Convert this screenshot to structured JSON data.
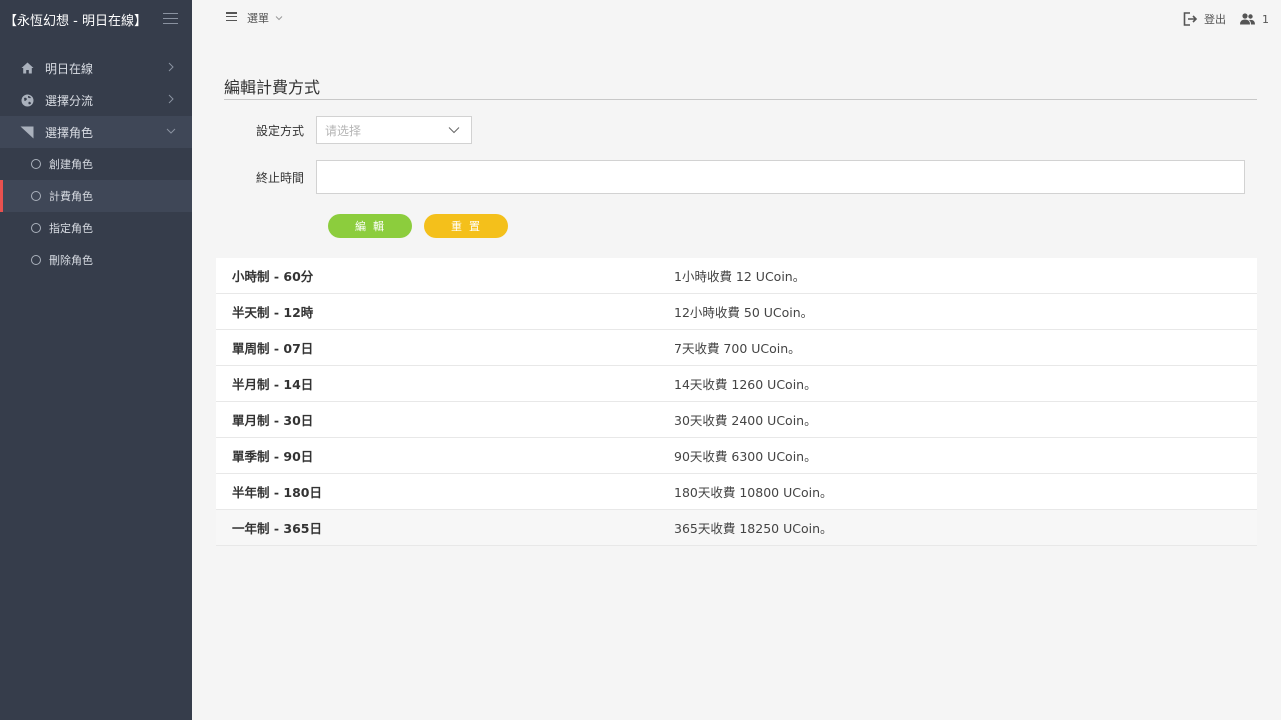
{
  "app": {
    "title": "【永恆幻想 - 明日在線】"
  },
  "sidebar": {
    "items": [
      {
        "label": "明日在線",
        "icon": "home-icon"
      },
      {
        "label": "選擇分流",
        "icon": "globe-icon"
      },
      {
        "label": "選擇角色",
        "icon": "flag-icon"
      }
    ],
    "subitems": [
      {
        "label": "創建角色"
      },
      {
        "label": "計費角色"
      },
      {
        "label": "指定角色"
      },
      {
        "label": "刪除角色"
      }
    ]
  },
  "topbar": {
    "menu_label": "選單",
    "logout_label": "登出",
    "user_count": "1"
  },
  "form": {
    "title": "編輯計費方式",
    "method_label": "設定方式",
    "method_placeholder": "请选择",
    "end_time_label": "終止時間",
    "end_time_value": "",
    "edit_button": "編輯",
    "reset_button": "重置"
  },
  "plans": [
    {
      "plan": "小時制 - 60分",
      "desc": "1小時收費 12 UCoin。"
    },
    {
      "plan": "半天制 - 12時",
      "desc": "12小時收費 50 UCoin。"
    },
    {
      "plan": "單周制 - 07日",
      "desc": "7天收費 700 UCoin。"
    },
    {
      "plan": "半月制 - 14日",
      "desc": "14天收費 1260 UCoin。"
    },
    {
      "plan": "單月制 - 30日",
      "desc": "30天收費 2400 UCoin。"
    },
    {
      "plan": "單季制 - 90日",
      "desc": "90天收費 6300 UCoin。"
    },
    {
      "plan": "半年制 - 180日",
      "desc": "180天收費 10800 UCoin。"
    },
    {
      "plan": "一年制 - 365日",
      "desc": "365天收費 18250 UCoin。"
    }
  ],
  "colors": {
    "sidebar_bg": "#363d4b",
    "accent_red": "#e8514f",
    "edit_green": "#8ccd3d",
    "reset_yellow": "#f4c01b"
  }
}
